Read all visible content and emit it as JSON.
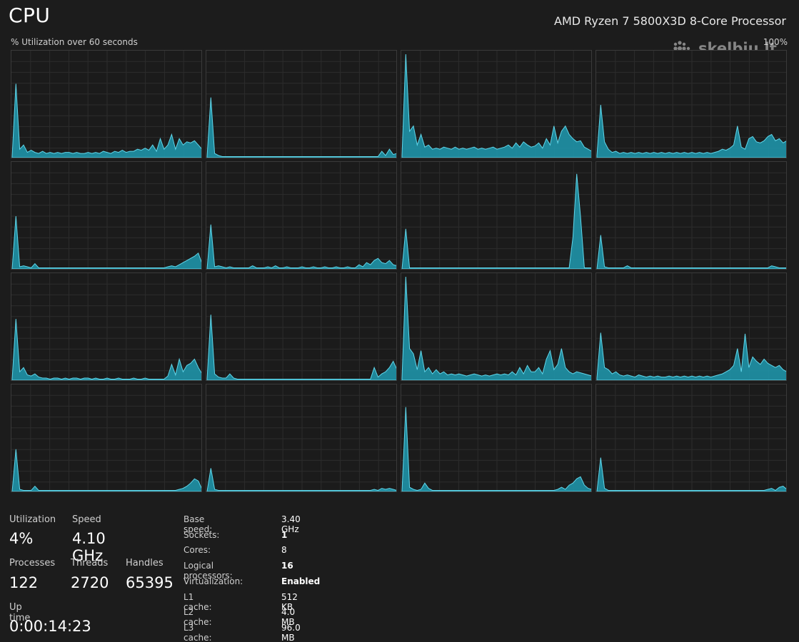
{
  "header": {
    "title": "CPU",
    "processor": "AMD Ryzen 7 5800X3D 8-Core Processor",
    "subtitle": "% Utilization over 60 seconds",
    "max_label": "100%"
  },
  "watermark": {
    "text": "skelbiu.lt"
  },
  "colors": {
    "background": "#1c1c1c",
    "graph_fill": "#1f9ab0",
    "graph_line": "#5fd6ea",
    "grid_line": "#2c2c2c",
    "border": "#3a3a3a"
  },
  "chart_data": {
    "type": "area",
    "grid": true,
    "ylim": [
      0,
      100
    ],
    "xlim": [
      0,
      60
    ],
    "series": [
      {
        "values": [
          1,
          70,
          8,
          12,
          5,
          7,
          5,
          4,
          6,
          4,
          5,
          4,
          5,
          4,
          5,
          5,
          4,
          5,
          4,
          4,
          5,
          4,
          5,
          4,
          6,
          5,
          4,
          6,
          5,
          7,
          5,
          6,
          6,
          8,
          7,
          9,
          7,
          12,
          6,
          18,
          8,
          12,
          22,
          8,
          18,
          12,
          15,
          14,
          16,
          12,
          8
        ]
      },
      {
        "values": [
          1,
          57,
          4,
          2,
          1,
          1,
          1,
          1,
          1,
          1,
          1,
          1,
          1,
          1,
          1,
          1,
          1,
          1,
          1,
          1,
          1,
          1,
          1,
          1,
          1,
          1,
          1,
          1,
          1,
          1,
          1,
          1,
          1,
          1,
          1,
          1,
          1,
          1,
          1,
          1,
          1,
          1,
          1,
          1,
          1,
          1,
          6,
          2,
          8,
          3,
          4
        ]
      },
      {
        "values": [
          2,
          98,
          25,
          30,
          12,
          22,
          10,
          12,
          8,
          9,
          8,
          10,
          9,
          8,
          10,
          8,
          9,
          8,
          9,
          10,
          8,
          9,
          8,
          9,
          10,
          8,
          9,
          10,
          12,
          9,
          14,
          10,
          15,
          12,
          10,
          11,
          14,
          9,
          18,
          12,
          30,
          14,
          25,
          30,
          22,
          18,
          15,
          16,
          10,
          8,
          6
        ]
      },
      {
        "values": [
          2,
          50,
          15,
          8,
          5,
          6,
          4,
          5,
          4,
          5,
          4,
          5,
          4,
          5,
          4,
          5,
          4,
          5,
          4,
          5,
          4,
          5,
          4,
          5,
          4,
          5,
          4,
          5,
          4,
          5,
          4,
          5,
          6,
          8,
          7,
          9,
          12,
          30,
          10,
          8,
          18,
          20,
          15,
          14,
          16,
          20,
          22,
          16,
          18,
          14,
          16
        ]
      },
      {
        "values": [
          0,
          50,
          2,
          3,
          2,
          1,
          5,
          1,
          1,
          1,
          1,
          1,
          1,
          1,
          1,
          1,
          1,
          1,
          1,
          1,
          1,
          1,
          1,
          1,
          1,
          1,
          1,
          1,
          1,
          1,
          1,
          1,
          1,
          1,
          1,
          1,
          1,
          1,
          1,
          1,
          1,
          2,
          3,
          2,
          4,
          6,
          8,
          10,
          12,
          15,
          5
        ]
      },
      {
        "values": [
          0,
          42,
          2,
          3,
          2,
          1,
          2,
          1,
          1,
          1,
          1,
          1,
          3,
          1,
          1,
          1,
          2,
          1,
          3,
          1,
          1,
          2,
          1,
          1,
          1,
          2,
          1,
          1,
          2,
          1,
          1,
          2,
          1,
          1,
          2,
          1,
          1,
          2,
          1,
          1,
          4,
          2,
          6,
          4,
          8,
          10,
          6,
          5,
          8,
          4,
          3
        ]
      },
      {
        "values": [
          0,
          38,
          1,
          1,
          1,
          1,
          1,
          1,
          1,
          1,
          1,
          1,
          1,
          1,
          1,
          1,
          1,
          1,
          1,
          1,
          1,
          1,
          1,
          1,
          1,
          1,
          1,
          1,
          1,
          1,
          1,
          1,
          1,
          1,
          1,
          1,
          1,
          1,
          1,
          1,
          1,
          1,
          1,
          1,
          1,
          30,
          90,
          50,
          1,
          1,
          1
        ]
      },
      {
        "values": [
          0,
          32,
          2,
          1,
          1,
          1,
          1,
          1,
          3,
          1,
          1,
          1,
          1,
          1,
          1,
          1,
          1,
          1,
          1,
          1,
          1,
          1,
          1,
          1,
          1,
          1,
          1,
          1,
          1,
          1,
          1,
          1,
          1,
          1,
          1,
          1,
          1,
          1,
          1,
          1,
          1,
          1,
          1,
          1,
          1,
          1,
          3,
          2,
          1,
          1,
          1
        ]
      },
      {
        "values": [
          1,
          58,
          8,
          12,
          5,
          4,
          6,
          3,
          2,
          2,
          1,
          2,
          2,
          1,
          2,
          1,
          2,
          2,
          1,
          2,
          2,
          1,
          2,
          1,
          1,
          2,
          1,
          1,
          2,
          1,
          1,
          1,
          2,
          1,
          1,
          2,
          1,
          1,
          1,
          1,
          1,
          4,
          15,
          5,
          20,
          8,
          14,
          16,
          20,
          12,
          6
        ]
      },
      {
        "values": [
          1,
          62,
          6,
          3,
          2,
          2,
          6,
          2,
          1,
          1,
          1,
          1,
          1,
          1,
          1,
          1,
          1,
          1,
          1,
          1,
          1,
          1,
          1,
          1,
          1,
          1,
          1,
          1,
          1,
          1,
          1,
          1,
          1,
          1,
          1,
          1,
          1,
          1,
          1,
          1,
          1,
          1,
          1,
          1,
          12,
          3,
          6,
          8,
          12,
          18,
          10
        ]
      },
      {
        "values": [
          2,
          98,
          30,
          25,
          10,
          28,
          8,
          12,
          6,
          10,
          6,
          8,
          5,
          6,
          5,
          6,
          5,
          4,
          5,
          6,
          5,
          4,
          5,
          4,
          5,
          6,
          5,
          6,
          5,
          8,
          5,
          12,
          6,
          14,
          8,
          8,
          12,
          6,
          20,
          28,
          10,
          15,
          30,
          12,
          8,
          6,
          8,
          7,
          6,
          5,
          4
        ]
      },
      {
        "values": [
          2,
          45,
          12,
          10,
          6,
          8,
          5,
          4,
          5,
          4,
          3,
          5,
          4,
          3,
          4,
          3,
          4,
          3,
          3,
          4,
          3,
          4,
          3,
          4,
          3,
          4,
          3,
          4,
          3,
          4,
          3,
          4,
          5,
          6,
          8,
          10,
          14,
          30,
          8,
          44,
          12,
          22,
          18,
          15,
          20,
          16,
          14,
          12,
          14,
          10,
          8
        ]
      },
      {
        "values": [
          0,
          40,
          2,
          1,
          1,
          1,
          5,
          1,
          1,
          1,
          1,
          1,
          1,
          1,
          1,
          1,
          1,
          1,
          1,
          1,
          1,
          1,
          1,
          1,
          1,
          1,
          1,
          1,
          1,
          1,
          1,
          1,
          1,
          1,
          1,
          1,
          1,
          1,
          1,
          1,
          1,
          1,
          1,
          1,
          2,
          3,
          5,
          8,
          12,
          10,
          2
        ]
      },
      {
        "values": [
          0,
          22,
          2,
          1,
          1,
          1,
          1,
          1,
          1,
          1,
          1,
          1,
          1,
          1,
          1,
          1,
          1,
          1,
          1,
          1,
          1,
          1,
          1,
          1,
          1,
          1,
          1,
          1,
          1,
          1,
          1,
          1,
          1,
          1,
          1,
          1,
          1,
          1,
          1,
          1,
          1,
          1,
          1,
          1,
          2,
          1,
          3,
          2,
          3,
          2,
          1
        ]
      },
      {
        "values": [
          0,
          80,
          4,
          2,
          1,
          2,
          8,
          3,
          1,
          1,
          1,
          1,
          1,
          1,
          1,
          1,
          1,
          1,
          1,
          1,
          1,
          1,
          1,
          1,
          1,
          1,
          1,
          1,
          1,
          1,
          1,
          1,
          1,
          1,
          1,
          1,
          1,
          1,
          1,
          1,
          1,
          2,
          4,
          2,
          6,
          8,
          12,
          14,
          6,
          3,
          2
        ]
      },
      {
        "values": [
          0,
          32,
          3,
          1,
          1,
          1,
          1,
          1,
          1,
          1,
          1,
          1,
          1,
          1,
          1,
          1,
          1,
          1,
          1,
          1,
          1,
          1,
          1,
          1,
          1,
          1,
          1,
          1,
          1,
          1,
          1,
          1,
          1,
          1,
          1,
          1,
          1,
          1,
          1,
          1,
          1,
          1,
          1,
          1,
          1,
          2,
          3,
          1,
          4,
          5,
          2
        ]
      }
    ]
  },
  "stats": {
    "utilization_label": "Utilization",
    "utilization_value": "4%",
    "speed_label": "Speed",
    "speed_value": "4.10 GHz",
    "processes_label": "Processes",
    "processes_value": "122",
    "threads_label": "Threads",
    "threads_value": "2720",
    "handles_label": "Handles",
    "handles_value": "65395",
    "uptime_label": "Up time",
    "uptime_value": "0:00:14:23"
  },
  "specs": [
    {
      "key": "Base speed:",
      "value": "3.40 GHz",
      "bold": false
    },
    {
      "key": "Sockets:",
      "value": "1",
      "bold": true
    },
    {
      "key": "Cores:",
      "value": "8",
      "bold": false
    },
    {
      "key": "Logical processors:",
      "value": "16",
      "bold": true
    },
    {
      "key": "Virtualization:",
      "value": "Enabled",
      "bold": true
    },
    {
      "key": "L1 cache:",
      "value": "512 KB",
      "bold": false
    },
    {
      "key": "L2 cache:",
      "value": "4.0 MB",
      "bold": false
    },
    {
      "key": "L3 cache:",
      "value": "96.0 MB",
      "bold": false
    }
  ]
}
